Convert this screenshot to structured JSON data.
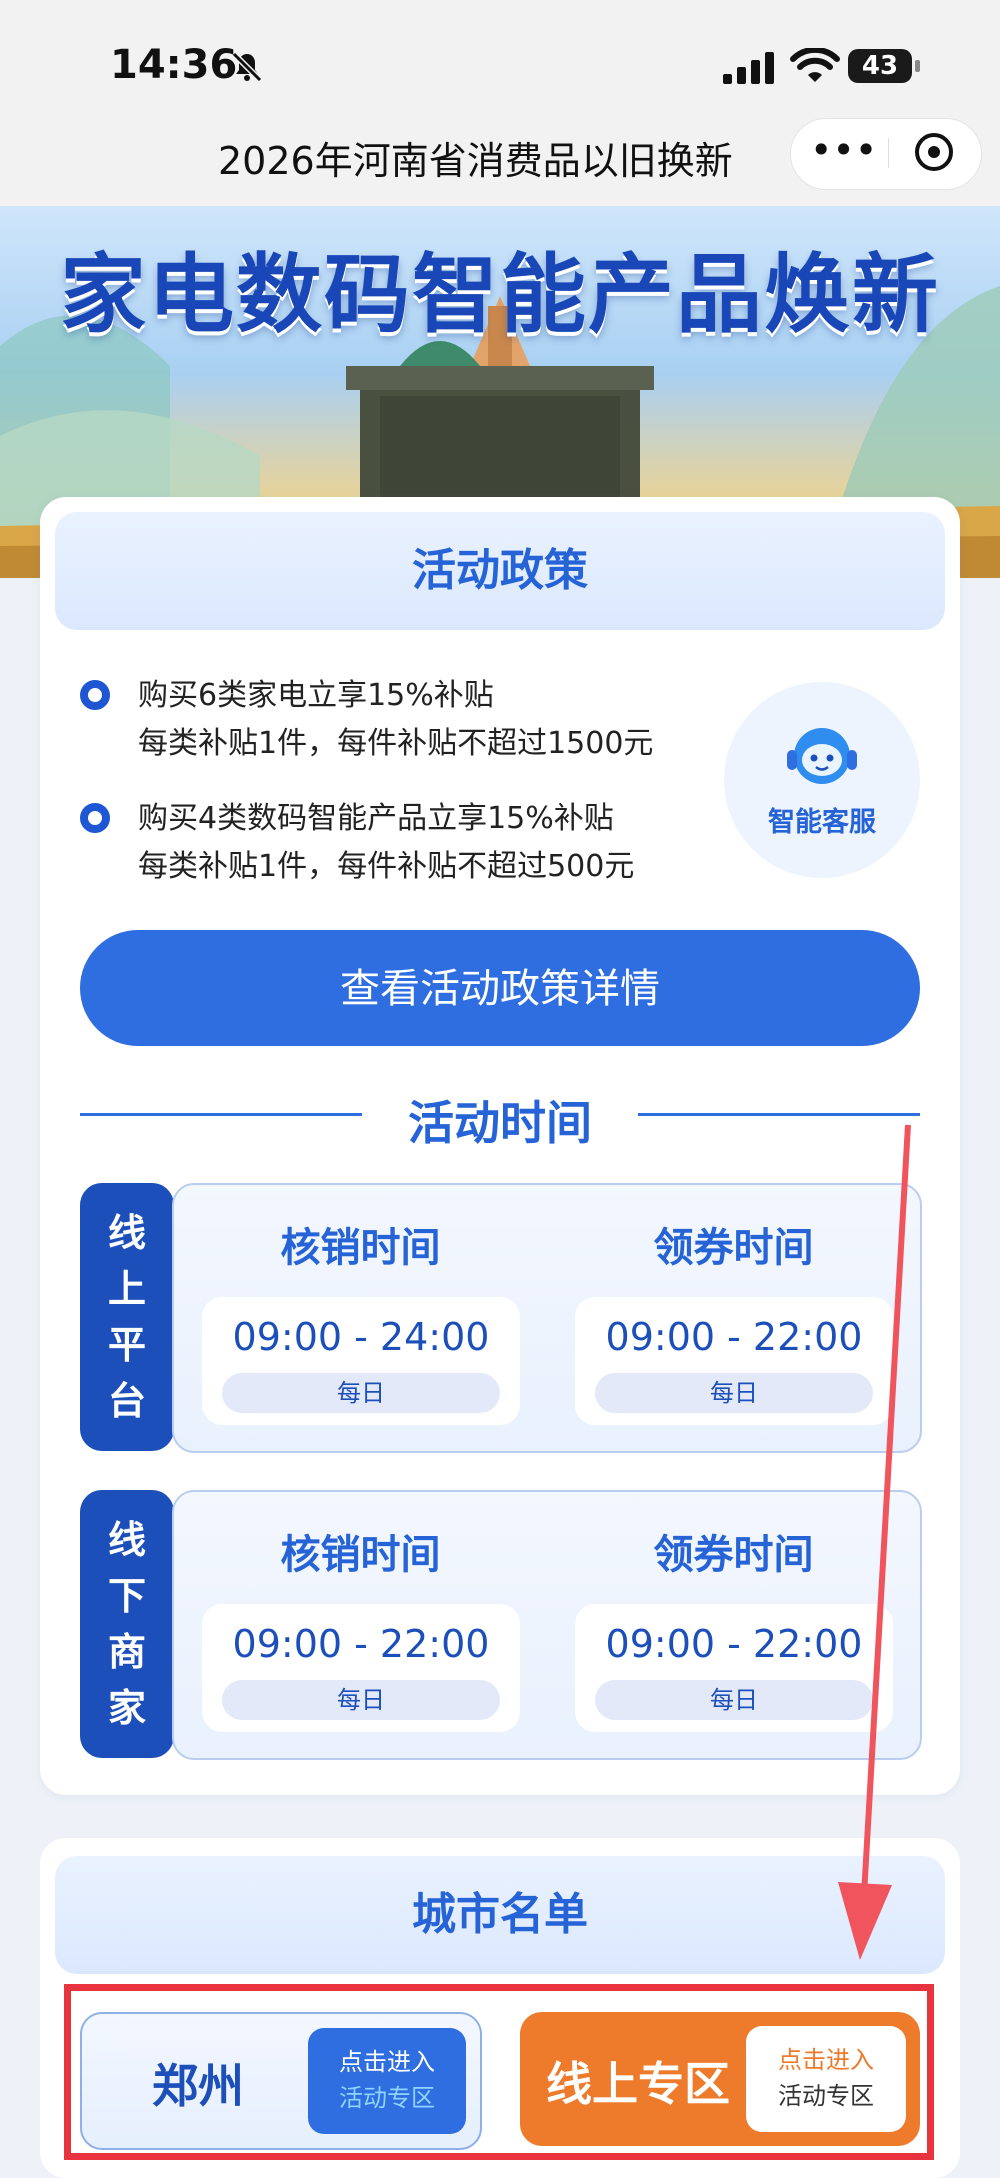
{
  "status_bar": {
    "time": "14:36",
    "battery": "43"
  },
  "nav": {
    "title": "2026年河南省消费品以旧换新",
    "more_label": "•••"
  },
  "banner": {
    "title": "家电数码智能产品焕新"
  },
  "policy": {
    "heading": "活动政策",
    "items": [
      {
        "line1": "购买6类家电立享15%补贴",
        "line2": "每类补贴1件，每件补贴不超过1500元"
      },
      {
        "line1": "购买4类数码智能产品立享15%补贴",
        "line2": "每类补贴1件，每件补贴不超过500元"
      }
    ],
    "customer_service_label": "智能客服",
    "detail_button": "查看活动政策详情"
  },
  "activity_time": {
    "heading": "活动时间",
    "blocks": [
      {
        "tab": [
          "线",
          "上",
          "平",
          "台"
        ],
        "columns": [
          {
            "title": "核销时间",
            "time": "09:00 - 24:00",
            "note": "每日"
          },
          {
            "title": "领券时间",
            "time": "09:00 - 22:00",
            "note": "每日"
          }
        ]
      },
      {
        "tab": [
          "线",
          "下",
          "商",
          "家"
        ],
        "columns": [
          {
            "title": "核销时间",
            "time": "09:00 - 22:00",
            "note": "每日"
          },
          {
            "title": "领券时间",
            "time": "09:00 - 22:00",
            "note": "每日"
          }
        ]
      }
    ]
  },
  "city_list": {
    "heading": "城市名单",
    "city": {
      "name": "郑州",
      "btn_line1": "点击进入",
      "btn_line2": "活动专区"
    },
    "online": {
      "name": "线上专区",
      "btn_line1": "点击进入",
      "btn_line2": "活动专区"
    }
  },
  "colors": {
    "brand_blue": "#2f6ee0",
    "dark_blue": "#1d4fba",
    "orange": "#ee7a2b",
    "annotation_red": "#e8343f"
  }
}
